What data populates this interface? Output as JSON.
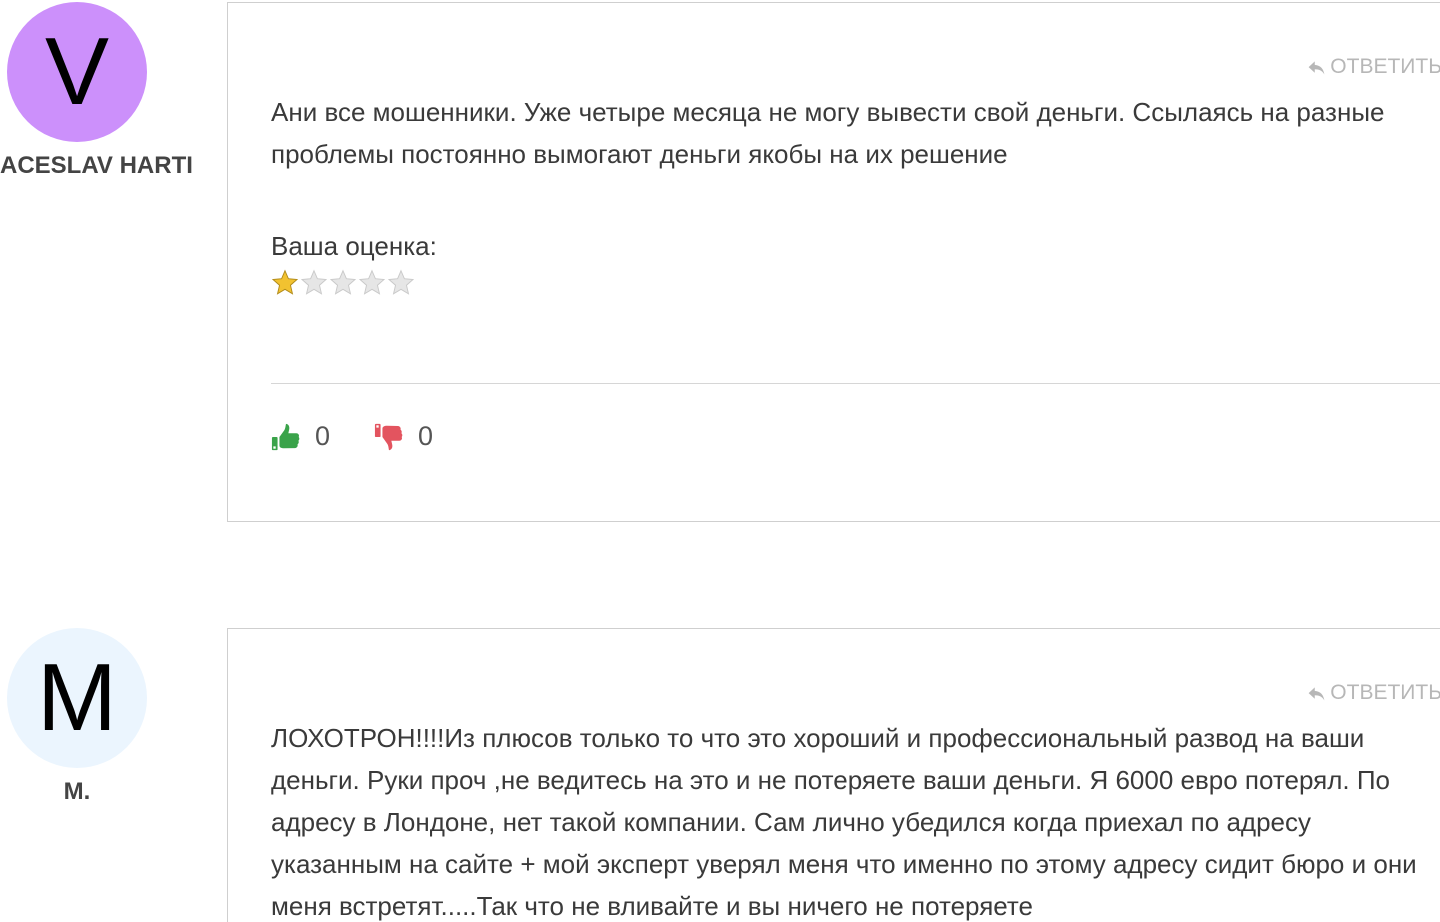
{
  "comments": [
    {
      "author_initial": "V",
      "author_name": "ACESLAV HARTI",
      "avatar_color": "#cc90fb",
      "reply_label": "ОТВЕТИТЬ",
      "text": "Ани все мошенники. Уже четыре месяца не могу вывести свой деньги. Ссылаясь на разные проблемы постоянно вымогают деньги якобы на их решение",
      "rating_label": "Ваша оценка:",
      "rating": 1,
      "rating_max": 5,
      "likes": "0",
      "dislikes": "0"
    },
    {
      "author_initial": "M",
      "author_name": "M.",
      "avatar_color": "#ebf5fe",
      "reply_label": "ОТВЕТИТЬ",
      "text": "ЛОХОТРОН!!!!Из плюсов только то что это хороший и профессиональный развод на ваши деньги. Руки проч ,не ведитесь на это и не потеряете ваши деньги. Я 6000 евро потерял. По адресу в Лондоне, нет такой компании. Сам лично убедился когда приехал по адресу указанным на сайте + мой эксперт уверял меня что именно по этому адресу сидит бюро и они меня встретят.....Так что не вливайте и вы ничего не потеряете"
    }
  ],
  "colors": {
    "like": "#3aa34a",
    "dislike": "#e3545f",
    "star_filled": "#f2c230",
    "star_empty": "#e6e6e6",
    "reply": "#b7b7b7",
    "border": "#cfcfcf"
  },
  "icons": {
    "reply": "reply-arrow-icon",
    "like": "thumbs-up-icon",
    "dislike": "thumbs-down-icon",
    "star": "star-icon"
  }
}
